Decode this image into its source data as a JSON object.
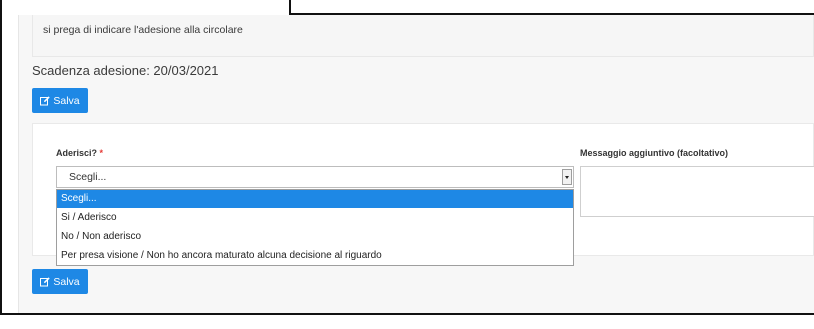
{
  "notice": {
    "message": "si prega di indicare l'adesione alla circolare"
  },
  "deadline": {
    "text": "Scadenza adesione: 20/03/2021"
  },
  "buttons": {
    "save_label": "Salva"
  },
  "form": {
    "adhesion_label": "Aderisci?",
    "required_mark": "*",
    "message_label": "Messaggio aggiuntivo (facoltativo)",
    "select_value": "Scegli...",
    "options": [
      "Scegli...",
      "Si / Aderisco",
      "No / Non aderisco",
      "Per presa visione / Non ho ancora maturato alcuna decisione al riguardo"
    ]
  },
  "colors": {
    "accent": "#1e88e5",
    "required": "#e53935"
  },
  "icons": {
    "save": "edit-icon",
    "dropdown": "chevron-down-icon"
  }
}
